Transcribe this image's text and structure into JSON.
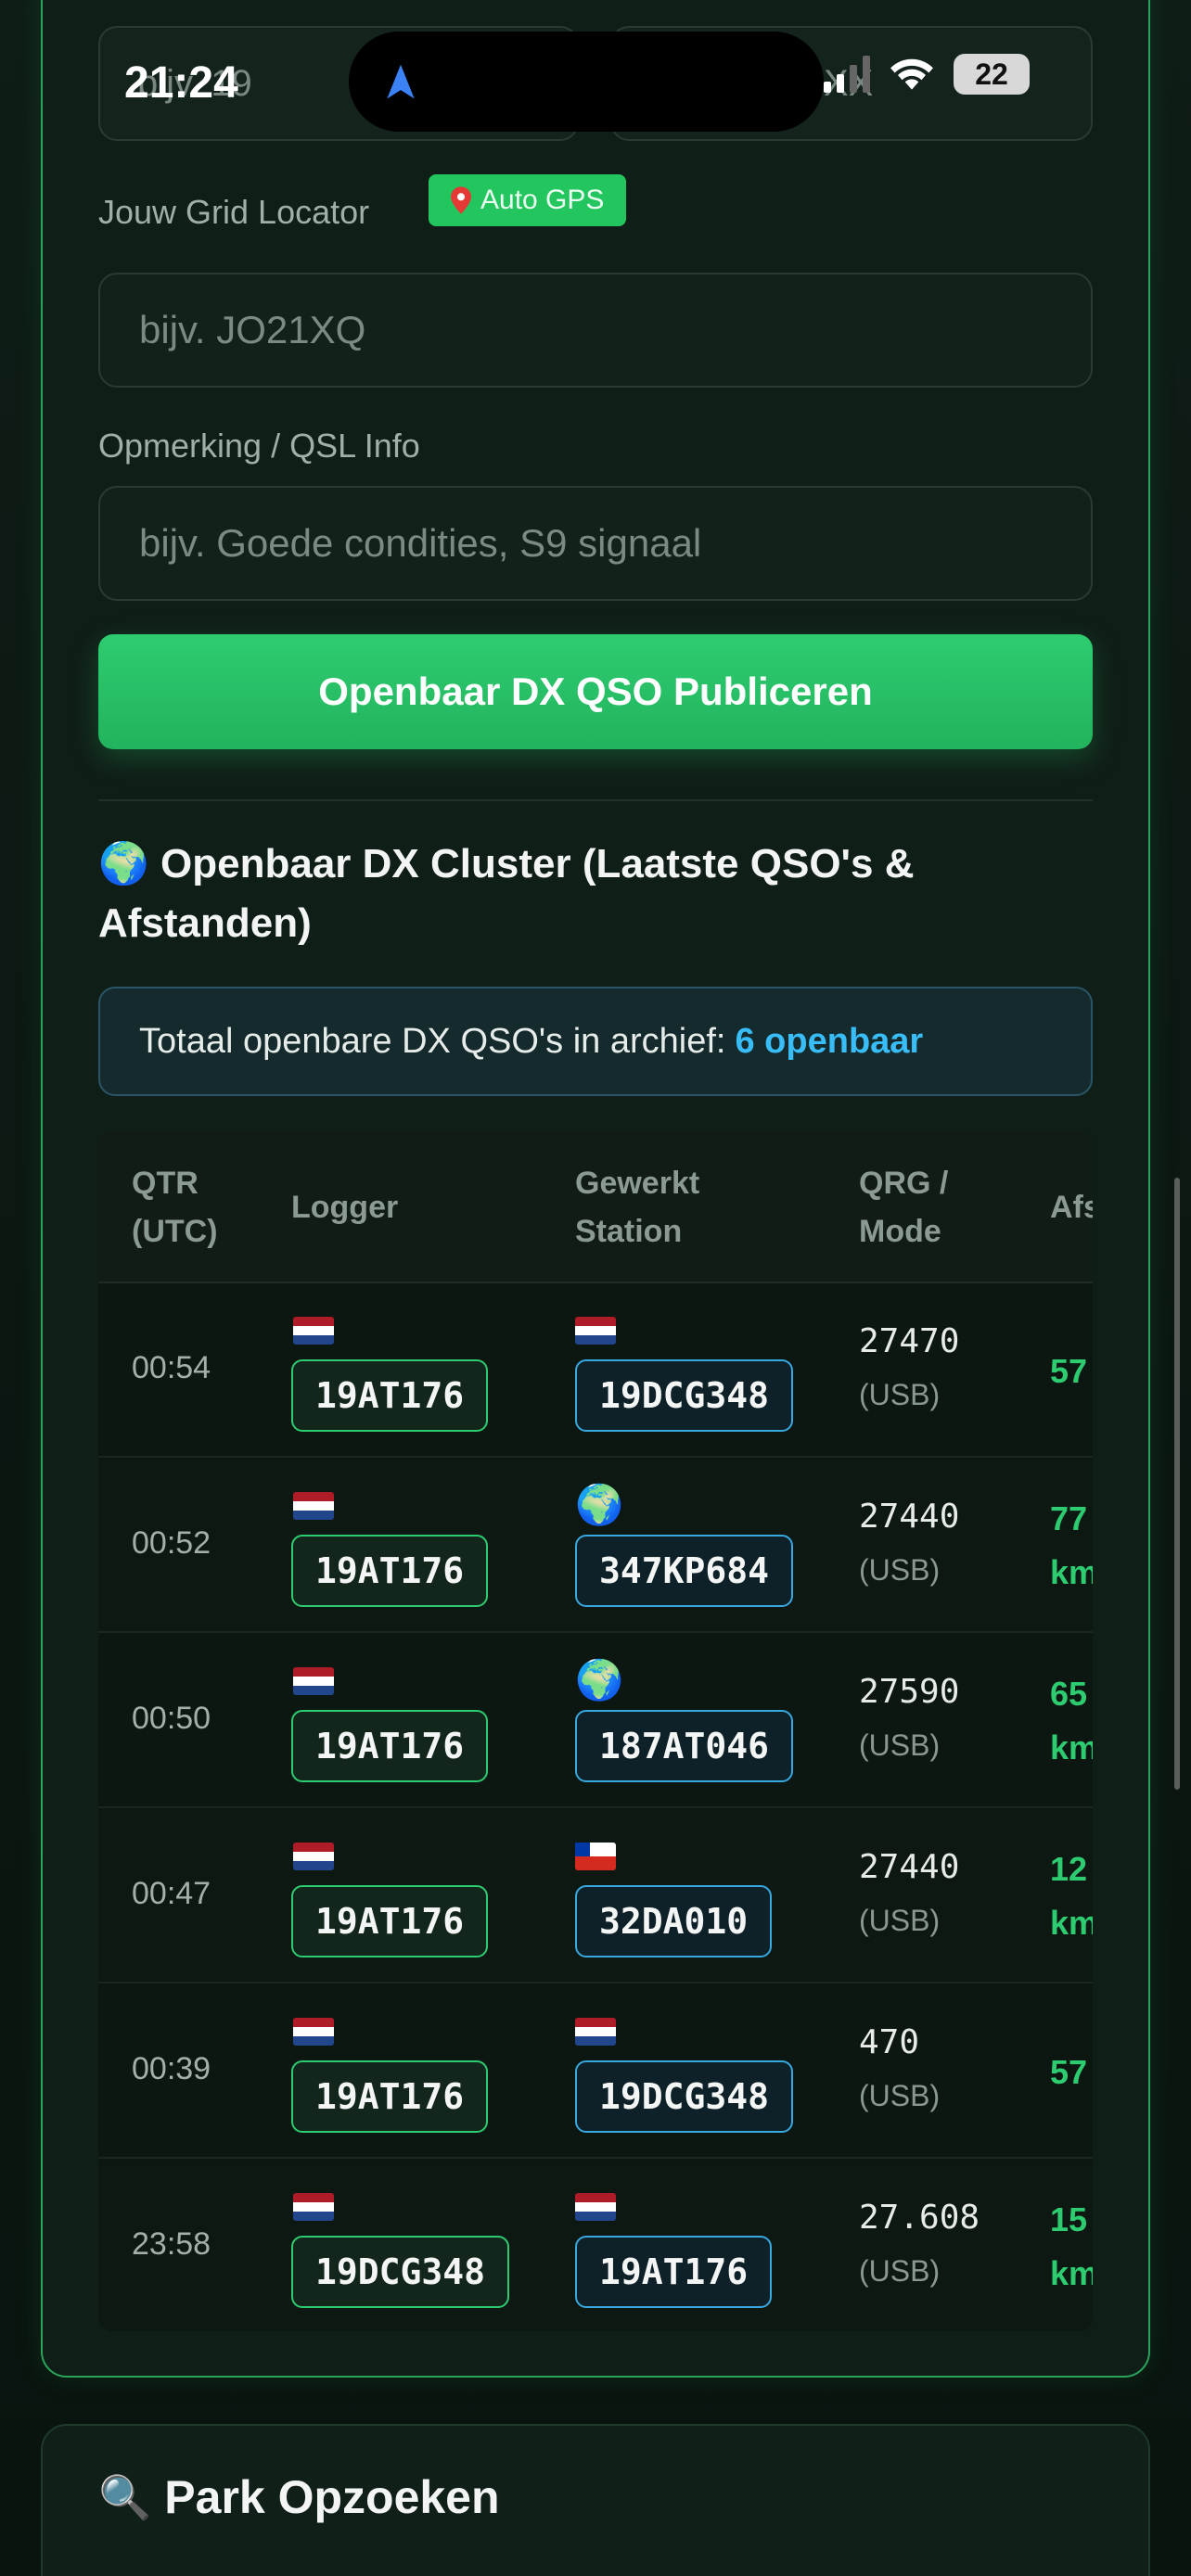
{
  "status": {
    "time": "21:24",
    "battery": "22",
    "ghost_left": "bijv. 19",
    "ghost_right": "XX"
  },
  "form": {
    "grid_label": "Jouw Grid Locator",
    "gps_badge": "Auto GPS",
    "grid_placeholder": "bijv. JO21XQ",
    "note_label": "Opmerking / QSL Info",
    "note_placeholder": "bijv. Goede condities, S9 signaal",
    "publish_label": "Openbaar DX QSO Publiceren"
  },
  "cluster": {
    "title": "Openbaar DX Cluster (Laatste QSO's & Afstanden)",
    "total_prefix": "Totaal openbare DX QSO's in archief:",
    "total_count": "6 openbaar",
    "headers": {
      "qtr": "QTR (UTC)",
      "logger": "Logger",
      "worked": "Gewerkt Station",
      "qrg": "QRG / Mode",
      "dist": "Afs"
    },
    "rows": [
      {
        "time": "00:54",
        "logger_flag": "nl",
        "logger": "19AT176",
        "worked_flag": "nl",
        "worked": "19DCG348",
        "qrg": "27470",
        "mode": "(USB)",
        "dist1": "57",
        "dist2": ""
      },
      {
        "time": "00:52",
        "logger_flag": "nl",
        "logger": "19AT176",
        "worked_flag": "globe",
        "worked": "347KP684",
        "qrg": "27440",
        "mode": "(USB)",
        "dist1": "77",
        "dist2": "km"
      },
      {
        "time": "00:50",
        "logger_flag": "nl",
        "logger": "19AT176",
        "worked_flag": "globe",
        "worked": "187AT046",
        "qrg": "27590",
        "mode": "(USB)",
        "dist1": "65",
        "dist2": "km"
      },
      {
        "time": "00:47",
        "logger_flag": "nl",
        "logger": "19AT176",
        "worked_flag": "cl",
        "worked": "32DA010",
        "qrg": "27440",
        "mode": "(USB)",
        "dist1": "12",
        "dist2": "km"
      },
      {
        "time": "00:39",
        "logger_flag": "nl",
        "logger": "19AT176",
        "worked_flag": "nl",
        "worked": "19DCG348",
        "qrg": "470",
        "mode": "(USB)",
        "dist1": "57",
        "dist2": ""
      },
      {
        "time": "23:58",
        "logger_flag": "nl",
        "logger": "19DCG348",
        "worked_flag": "nl",
        "worked": "19AT176",
        "qrg": "27.608",
        "mode": "(USB)",
        "dist1": "15",
        "dist2": "km"
      }
    ]
  },
  "park": {
    "title": "Park Opzoeken"
  },
  "colors": {
    "accent": "#22c55e",
    "link": "#38bdf8"
  }
}
